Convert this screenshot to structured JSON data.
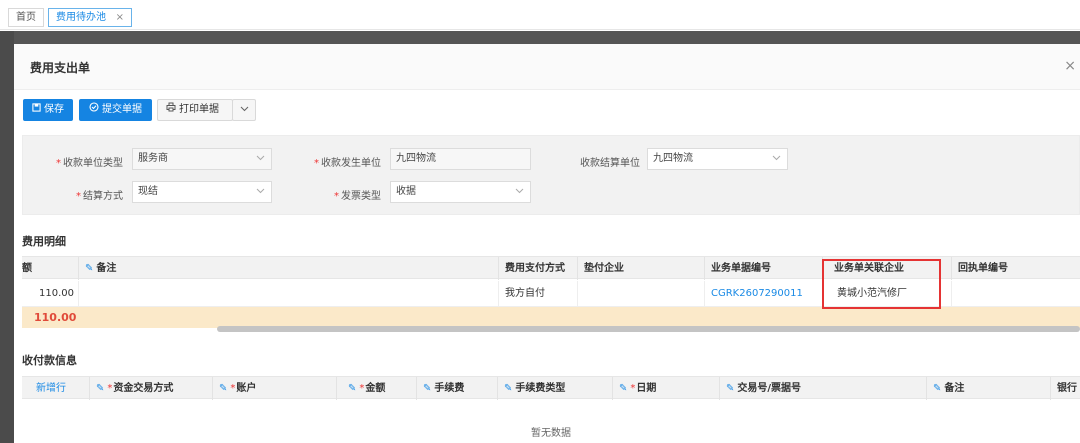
{
  "tabs": [
    {
      "label": "首页"
    },
    {
      "label": "费用待办池",
      "close": "×"
    }
  ],
  "modal": {
    "title": "费用支出单",
    "close": "×"
  },
  "toolbar": {
    "save_label": "保存",
    "submit_label": "提交单据",
    "print_label": "打印单据"
  },
  "form": {
    "payee_type": {
      "label": "收款单位类型",
      "value": "服务商"
    },
    "payee_unit": {
      "label": "收款发生单位",
      "value": "九四物流"
    },
    "settle_unit": {
      "label": "收款结算单位",
      "value": "九四物流"
    },
    "settle_method": {
      "label": "结算方式",
      "value": "现结"
    },
    "invoice_type": {
      "label": "发票类型",
      "value": "收据"
    }
  },
  "expense": {
    "section_title": "费用明细",
    "columns": [
      "额",
      "备注",
      "费用支付方式",
      "垫付企业",
      "业务单据编号",
      "业务单关联企业",
      "回执单编号"
    ],
    "row": {
      "amount": "110.00",
      "remark": "",
      "pay_method": "我方自付",
      "advance_company": "",
      "doc_no": "CGRK2607290011",
      "related_company": "黄城小范汽修厂",
      "receipt_no": ""
    },
    "total": "110.00"
  },
  "payment": {
    "section_title": "收付款信息",
    "add_row": "新增行",
    "columns": [
      "资金交易方式",
      "账户",
      "金额",
      "手续费",
      "手续费类型",
      "日期",
      "交易号/票据号",
      "备注",
      "银行"
    ],
    "empty_text": "暂无数据"
  },
  "colors": {
    "primary": "#1584e2",
    "highlight": "#e53333",
    "total_bg": "#fbe9c9",
    "total_text": "#e04a3a"
  }
}
